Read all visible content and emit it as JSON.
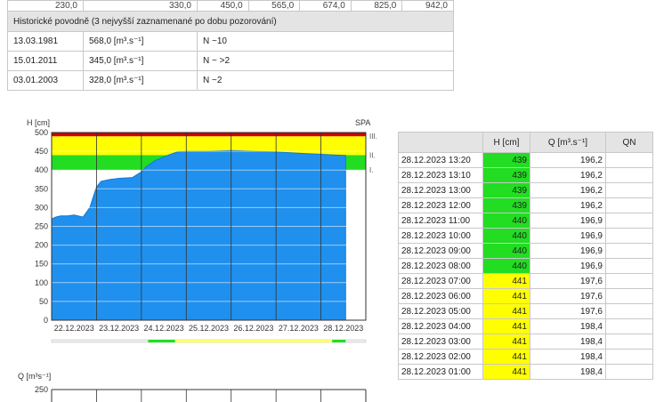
{
  "top_partial_values": [
    "230,0",
    "330,0",
    "450,0",
    "565,0",
    "674,0",
    "825,0",
    "942,0"
  ],
  "historic_header": "Historické povodně (3 nejvyšší zaznamenané po dobu pozorování)",
  "historic_rows": [
    {
      "date": "13.03.1981",
      "flow": "568,0 [m³.s⁻¹]",
      "n": "N ~10"
    },
    {
      "date": "15.01.2011",
      "flow": "345,0 [m³.s⁻¹]",
      "n": "N ~ >2"
    },
    {
      "date": "03.01.2003",
      "flow": "328,0 [m³.s⁻¹]",
      "n": "N ~2"
    }
  ],
  "chart_data": [
    {
      "type": "area",
      "ylabel": "H [cm]",
      "right_label": "SPA",
      "ylim": [
        0,
        500
      ],
      "yticks": [
        0,
        50,
        100,
        150,
        200,
        250,
        300,
        350,
        400,
        450,
        500
      ],
      "categories": [
        "22.12.2023",
        "23.12.2023",
        "24.12.2023",
        "25.12.2023",
        "26.12.2023",
        "27.12.2023",
        "28.12.2023"
      ],
      "x": [
        0,
        0.1,
        0.2,
        0.35,
        0.5,
        0.7,
        0.85,
        1.0,
        1.1,
        1.3,
        1.5,
        1.8,
        2.0,
        2.1,
        2.3,
        2.6,
        2.8,
        3.0,
        3.5,
        4.0,
        4.5,
        5.0,
        5.5,
        6.0,
        6.3,
        6.55
      ],
      "values": [
        270,
        275,
        278,
        278,
        280,
        275,
        300,
        355,
        370,
        375,
        378,
        380,
        395,
        408,
        425,
        440,
        448,
        450,
        450,
        452,
        450,
        448,
        445,
        442,
        440,
        439
      ],
      "thresholds": [
        {
          "label": "I.",
          "value": 400,
          "color": "#22dd22"
        },
        {
          "label": "II.",
          "value": 440,
          "color": "#ffff00"
        },
        {
          "label": "III.",
          "value": 490,
          "color": "#cc0000"
        }
      ],
      "series_color": "#2090ee"
    },
    {
      "type": "line",
      "ylabel": "Q [m³s⁻¹]",
      "yticks": [
        250
      ]
    }
  ],
  "side_table": {
    "headers": [
      "",
      "H [cm]",
      "Q [m³.s⁻¹]",
      "QN"
    ],
    "rows": [
      {
        "dt": "28.12.2023 13:20",
        "h": "439",
        "q": "196,2",
        "lvl": "g"
      },
      {
        "dt": "28.12.2023 13:10",
        "h": "439",
        "q": "196,2",
        "lvl": "g"
      },
      {
        "dt": "28.12.2023 13:00",
        "h": "439",
        "q": "196,2",
        "lvl": "g"
      },
      {
        "dt": "28.12.2023 12:00",
        "h": "439",
        "q": "196,2",
        "lvl": "g"
      },
      {
        "dt": "28.12.2023 11:00",
        "h": "440",
        "q": "196,9",
        "lvl": "g"
      },
      {
        "dt": "28.12.2023 10:00",
        "h": "440",
        "q": "196,9",
        "lvl": "g"
      },
      {
        "dt": "28.12.2023 09:00",
        "h": "440",
        "q": "196,9",
        "lvl": "g"
      },
      {
        "dt": "28.12.2023 08:00",
        "h": "440",
        "q": "196,9",
        "lvl": "g"
      },
      {
        "dt": "28.12.2023 07:00",
        "h": "441",
        "q": "197,6",
        "lvl": "y"
      },
      {
        "dt": "28.12.2023 06:00",
        "h": "441",
        "q": "197,6",
        "lvl": "y"
      },
      {
        "dt": "28.12.2023 05:00",
        "h": "441",
        "q": "197,6",
        "lvl": "y"
      },
      {
        "dt": "28.12.2023 04:00",
        "h": "441",
        "q": "198,4",
        "lvl": "y"
      },
      {
        "dt": "28.12.2023 03:00",
        "h": "441",
        "q": "198,4",
        "lvl": "y"
      },
      {
        "dt": "28.12.2023 02:00",
        "h": "441",
        "q": "198,4",
        "lvl": "y"
      },
      {
        "dt": "28.12.2023 01:00",
        "h": "441",
        "q": "198,4",
        "lvl": "y"
      }
    ]
  }
}
